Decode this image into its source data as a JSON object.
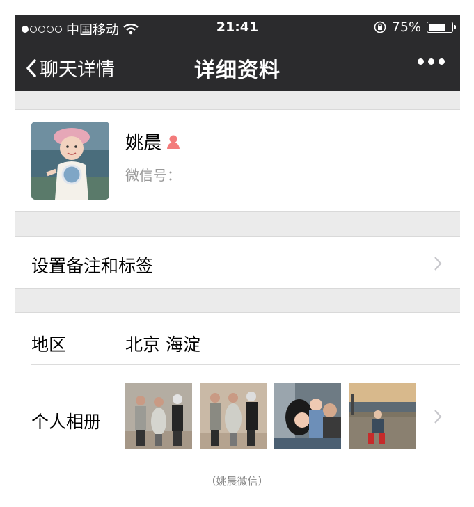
{
  "status_bar": {
    "carrier": "中国移动",
    "time": "21:41",
    "battery": "75%",
    "battery_level": 0.75
  },
  "nav": {
    "back_label": "聊天详情",
    "title": "详细资料"
  },
  "profile": {
    "name": "姚晨",
    "wechat_id_label": "微信号："
  },
  "remark_row": {
    "label": "设置备注和标签"
  },
  "region_row": {
    "label": "地区",
    "value": "北京 海淀"
  },
  "album_row": {
    "label": "个人相册"
  },
  "caption": "（姚晨微信）",
  "colors": {
    "header_bg": "#2b2b2d",
    "page_bg": "#ebebeb",
    "female_badge": "#f37b7b"
  }
}
